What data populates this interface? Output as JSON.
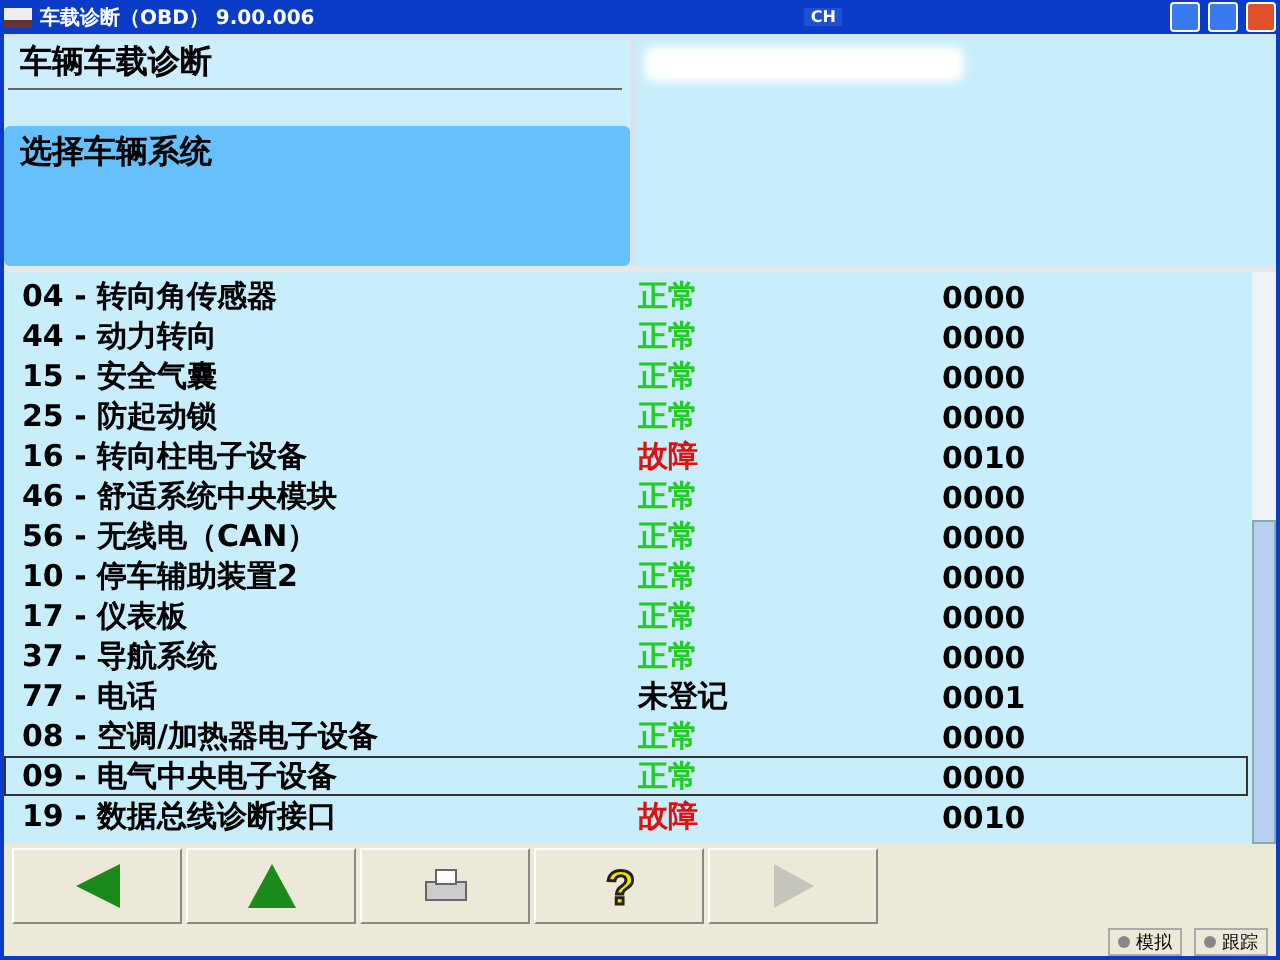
{
  "window": {
    "title": "车载诊断（OBD） 9.00.006",
    "tray": "CH"
  },
  "header": {
    "title": "车辆车载诊断",
    "subtitle": "选择车辆系统"
  },
  "systems": [
    {
      "name": "04 - 转向角传感器",
      "status": "正常",
      "color": "#22cc22",
      "value": "0000",
      "selected": false
    },
    {
      "name": "44 - 动力转向",
      "status": "正常",
      "color": "#22cc22",
      "value": "0000",
      "selected": false
    },
    {
      "name": "15 - 安全气囊",
      "status": "正常",
      "color": "#22cc22",
      "value": "0000",
      "selected": false
    },
    {
      "name": "25 - 防起动锁",
      "status": "正常",
      "color": "#22cc22",
      "value": "0000",
      "selected": false
    },
    {
      "name": "16 - 转向柱电子设备",
      "status": "故障",
      "color": "#dd1111",
      "value": "0010",
      "selected": false
    },
    {
      "name": "46 - 舒适系统中央模块",
      "status": "正常",
      "color": "#22cc22",
      "value": "0000",
      "selected": false
    },
    {
      "name": "56 - 无线电（CAN）",
      "status": "正常",
      "color": "#22cc22",
      "value": "0000",
      "selected": false
    },
    {
      "name": "10 - 停车辅助装置2",
      "status": "正常",
      "color": "#22cc22",
      "value": "0000",
      "selected": false
    },
    {
      "name": "17 - 仪表板",
      "status": "正常",
      "color": "#22cc22",
      "value": "0000",
      "selected": false
    },
    {
      "name": "37 - 导航系统",
      "status": "正常",
      "color": "#22cc22",
      "value": "0000",
      "selected": false
    },
    {
      "name": "77 - 电话",
      "status": "未登记",
      "color": "#000000",
      "value": "0001",
      "selected": false
    },
    {
      "name": "08 - 空调/加热器电子设备",
      "status": "正常",
      "color": "#22cc22",
      "value": "0000",
      "selected": false
    },
    {
      "name": "09 - 电气中央电子设备",
      "status": "正常",
      "color": "#22cc22",
      "value": "0000",
      "selected": true
    },
    {
      "name": "19 - 数据总线诊断接口",
      "status": "故障",
      "color": "#dd1111",
      "value": "0010",
      "selected": false
    }
  ],
  "toolbar": [
    {
      "kind": "back",
      "disabled": false
    },
    {
      "kind": "up",
      "disabled": false
    },
    {
      "kind": "print",
      "disabled": false
    },
    {
      "kind": "help",
      "label": "?",
      "disabled": false
    },
    {
      "kind": "next",
      "disabled": true
    }
  ],
  "status_bar": [
    {
      "label": "模拟",
      "on": false
    },
    {
      "label": "跟踪",
      "on": false
    }
  ]
}
